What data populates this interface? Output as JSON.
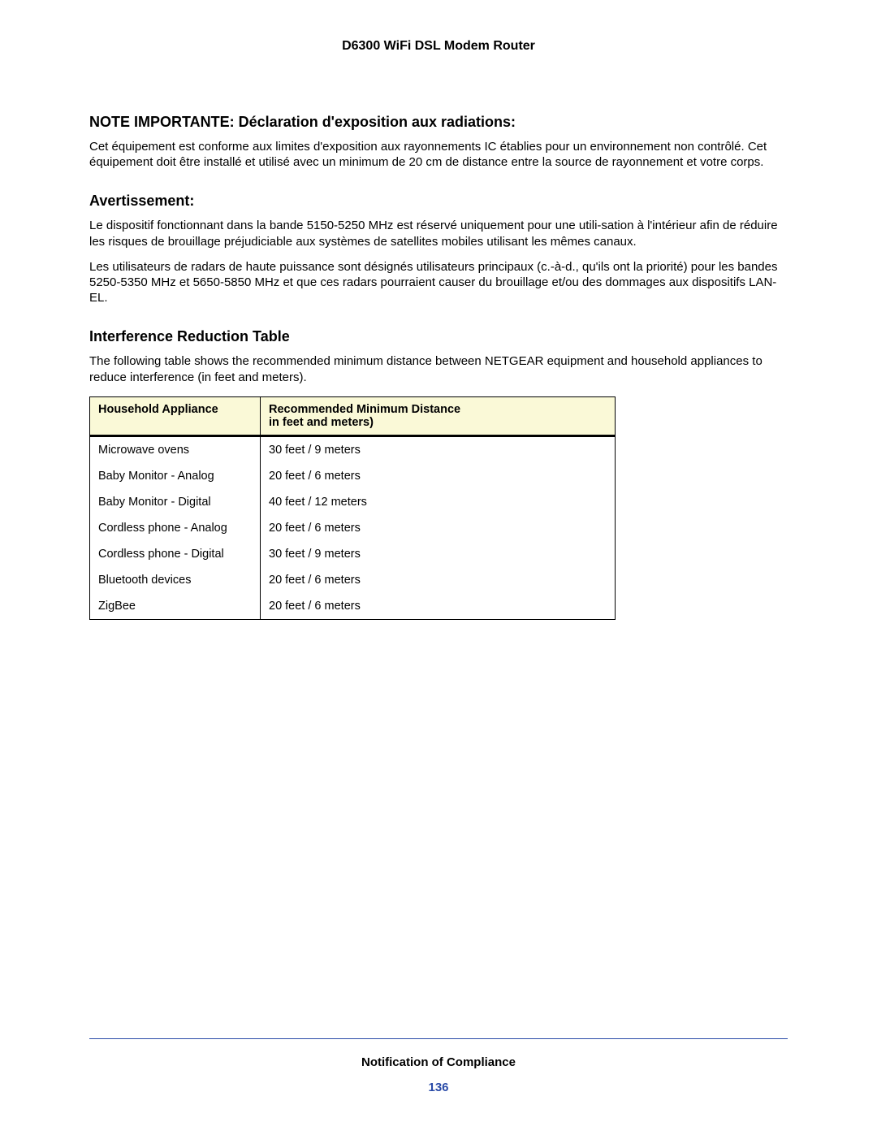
{
  "docTitle": "D6300 WiFi DSL Modem Router",
  "sections": {
    "note": {
      "heading": "NOTE IMPORTANTE: Déclaration d'exposition aux radiations:",
      "p1": "Cet équipement est conforme aux limites d'exposition aux rayonnements IC établies pour un environnement non contrôlé. Cet équipement doit être installé et utilisé avec un minimum de 20 cm de distance entre la source de rayonnement et votre corps."
    },
    "avert": {
      "heading": "Avertissement:",
      "p1": "Le dispositif fonctionnant dans la bande 5150-5250 MHz est réservé uniquement pour une utili-sation à l'intérieur afin de réduire les risques de brouillage préjudiciable aux systèmes de satellites mobiles utilisant les mêmes canaux.",
      "p2": "Les utilisateurs de radars de haute puissance sont désignés utilisateurs principaux (c.-à-d., qu'ils ont la priorité) pour les bandes 5250-5350 MHz et 5650-5850 MHz et que ces radars pourraient causer du brouillage et/ou des dommages aux dispositifs LAN-EL."
    },
    "interference": {
      "heading": "Interference Reduction Table",
      "p1": "The following table shows the recommended minimum distance between NETGEAR equipment and household appliances to reduce interference (in feet and meters)."
    }
  },
  "table": {
    "header": {
      "col1": "Household Appliance",
      "col2a": "Recommended Minimum Distance",
      "col2b": "in feet and meters)"
    },
    "rows": [
      {
        "appliance": "Microwave ovens",
        "distance": "30 feet / 9 meters"
      },
      {
        "appliance": "Baby Monitor - Analog",
        "distance": "20 feet / 6 meters"
      },
      {
        "appliance": "Baby Monitor - Digital",
        "distance": "40 feet / 12 meters"
      },
      {
        "appliance": "Cordless phone - Analog",
        "distance": "20 feet / 6 meters"
      },
      {
        "appliance": "Cordless phone - Digital",
        "distance": "30 feet / 9 meters"
      },
      {
        "appliance": "Bluetooth devices",
        "distance": "20 feet / 6 meters"
      },
      {
        "appliance": "ZigBee",
        "distance": "20 feet / 6 meters"
      }
    ]
  },
  "footer": {
    "title": "Notification of Compliance",
    "page": "136"
  }
}
